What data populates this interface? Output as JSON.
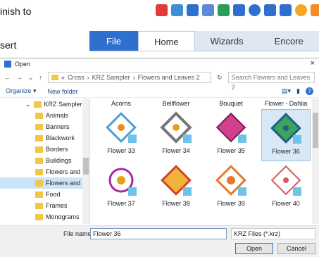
{
  "background": {
    "text1": "inish to",
    "text2": "sert"
  },
  "ribbon": {
    "tabs": [
      "File",
      "Home",
      "Wizards",
      "Encore"
    ]
  },
  "dialog": {
    "title": "Open",
    "address": {
      "parts": [
        "«",
        "Cross",
        "›",
        "KRZ Sampler",
        "›",
        "Flowers and Leaves 2"
      ],
      "search_placeholder": "Search Flowers and Leaves 2"
    },
    "toolbar": {
      "organize": "Organize ▾",
      "new_folder": "New folder"
    },
    "nav": {
      "root": "KRZ Sampler",
      "items": [
        "Animals",
        "Banners",
        "Blackwork",
        "Borders",
        "Buildings",
        "Flowers and Lea",
        "Flowers and Lea",
        "Food",
        "Frames",
        "Monograms"
      ]
    },
    "files": [
      "Acorns",
      "Bellflower",
      "Bouquet",
      "Flower - Dahlia",
      "Flower 33",
      "Flower 34",
      "Flower 35",
      "Flower 36",
      "Flower 37",
      "Flower 38",
      "Flower 39",
      "Flower 40"
    ],
    "selected_file": "Flower 36",
    "filename_label": "File name:",
    "filename_value": "Flower 36",
    "filetype": "KRZ Files (*.krz)",
    "open": "Open",
    "cancel": "Cancel"
  }
}
